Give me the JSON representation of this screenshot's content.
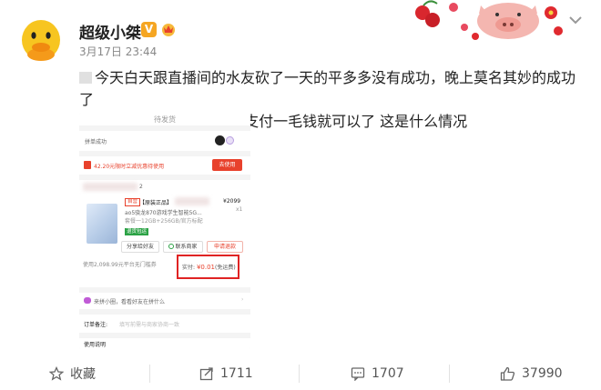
{
  "post": {
    "username": "超级小桀",
    "verified_mark": "V",
    "timestamp": "3月17日 23:44",
    "text_line1": "今天白天跟直播间的水友砍了一天的平多多没有成功，晚上莫名其妙的成功了",
    "text_line2": "给了我一个优惠券 只需要支付一毛钱就可以了 这是什么情况"
  },
  "screenshot": {
    "page_title": "待发货",
    "group_status": "拼单成功",
    "coupon_text": "42.20元限时立减优惠待使用",
    "coupon_button": "去使用",
    "store_number": "2",
    "tag_self_operated": "自营",
    "product_title": "【原装正品】",
    "product_sub1": "ao5骁龙870游戏学生智能5G...",
    "product_sub2": "套餐一12GB+256GB/官方标配",
    "product_price": "¥2099",
    "product_qty": "x1",
    "tag_free_return": "退货包运",
    "btn_share": "分享给好友",
    "btn_contact": "联系商家",
    "btn_refund": "申请退款",
    "coupon_note": "使用2,098.99元平台无门槛券",
    "pay_label": "实付:",
    "pay_amount": "¥0.01",
    "pay_shipping": "(免运费)",
    "invite_text": "来拼小圈，看看好友在拼什么",
    "order_note_label": "订单备注:",
    "order_note_placeholder": "填写前需与商家协商一致",
    "usage_label": "使用说明"
  },
  "actions": {
    "favorite": "收藏",
    "repost": "1711",
    "comment": "1707",
    "like": "37990"
  },
  "colors": {
    "accent_red": "#e8412c",
    "highlight_box": "#e02323",
    "verified": "#f5a623"
  }
}
